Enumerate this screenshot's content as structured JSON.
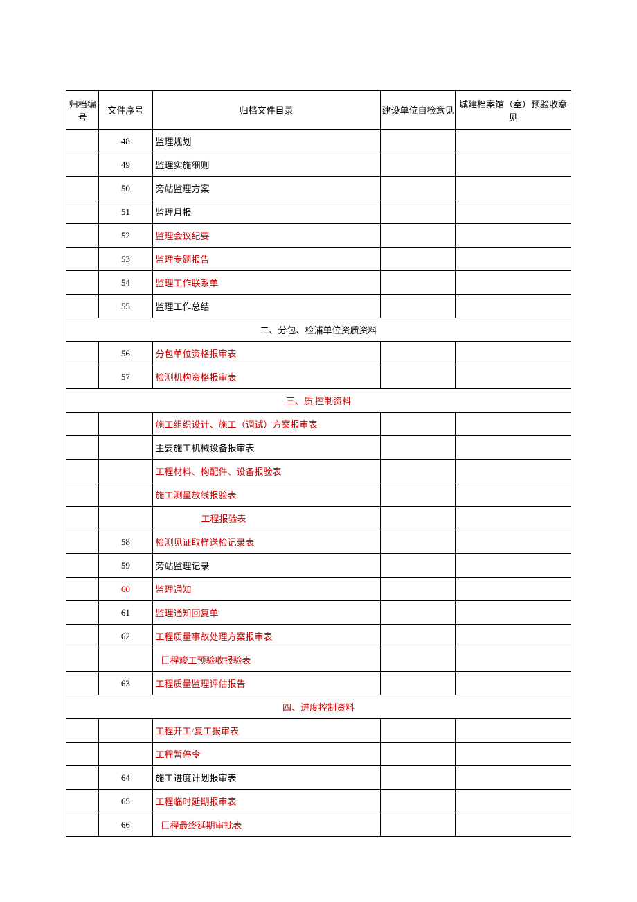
{
  "headers": {
    "h1": "归档编号",
    "h2": "文件序号",
    "h3": "归档文件目录",
    "h4": "建设单位自检意见",
    "h5": "城建档案馆（室）预验收意见"
  },
  "rows": [
    {
      "seq": "48",
      "title": "监理规划",
      "red": false
    },
    {
      "seq": "49",
      "title": "监理实施细则",
      "red": false
    },
    {
      "seq": "50",
      "title": "旁站监理方案",
      "red": false
    },
    {
      "seq": "51",
      "title": "监理月报",
      "red": false
    },
    {
      "seq": "52",
      "title": "监理会议纪要",
      "red": true
    },
    {
      "seq": "53",
      "title": "监理专题报告",
      "red": true
    },
    {
      "seq": "54",
      "title": "监理工作联系单",
      "red": true
    },
    {
      "seq": "55",
      "title": "监理工作总结",
      "red": false
    }
  ],
  "section2": "二、分包、检浦单位资质资料",
  "rows2": [
    {
      "seq": "56",
      "title": "分包单位资格报审表",
      "red": true
    },
    {
      "seq": "57",
      "title": "检测机构资格报审表",
      "red": true
    }
  ],
  "section3": "三、质,控制资料",
  "rows3": [
    {
      "seq": "",
      "title": "施工组织设计、施工（调试）方案报审表",
      "red": true
    },
    {
      "seq": "",
      "title": "主要施工机械设备报审表",
      "red": false
    },
    {
      "seq": "",
      "title": "工程材料、构配件、设备报验表",
      "red": true
    },
    {
      "seq": "",
      "title": "施工测量放线报验表",
      "red": true
    },
    {
      "seq": "",
      "title": "工程报验表",
      "red": true,
      "indent": true
    },
    {
      "seq": "58",
      "title": "检测见证取样送检记录表",
      "red": true
    },
    {
      "seq": "59",
      "title": "旁站监理记录",
      "red": false
    },
    {
      "seq": "60",
      "title": "监理通知",
      "red": true,
      "seqred": true
    },
    {
      "seq": "61",
      "title": "监理通知回复单",
      "red": true
    },
    {
      "seq": "62",
      "title": "工程质量事故处理方案报审表",
      "red": true
    },
    {
      "seq": "",
      "title": "匚程竣工预验收报验表",
      "red": true,
      "indent_s": true
    },
    {
      "seq": "63",
      "title": "工程质量监理评估报告",
      "red": true
    }
  ],
  "section4": "四、进度控制资料",
  "rows4": [
    {
      "seq": "",
      "title": "工程开工/复工报审表",
      "red": true
    },
    {
      "seq": "",
      "title": "工程暂停令",
      "red": true
    },
    {
      "seq": "64",
      "title": "施工进度计划报审表",
      "red": false
    },
    {
      "seq": "65",
      "title": "工程临时延期报审表",
      "red": true
    },
    {
      "seq": "66",
      "title": "匚程最终延期审批表",
      "red": true,
      "indent_s": true
    }
  ]
}
